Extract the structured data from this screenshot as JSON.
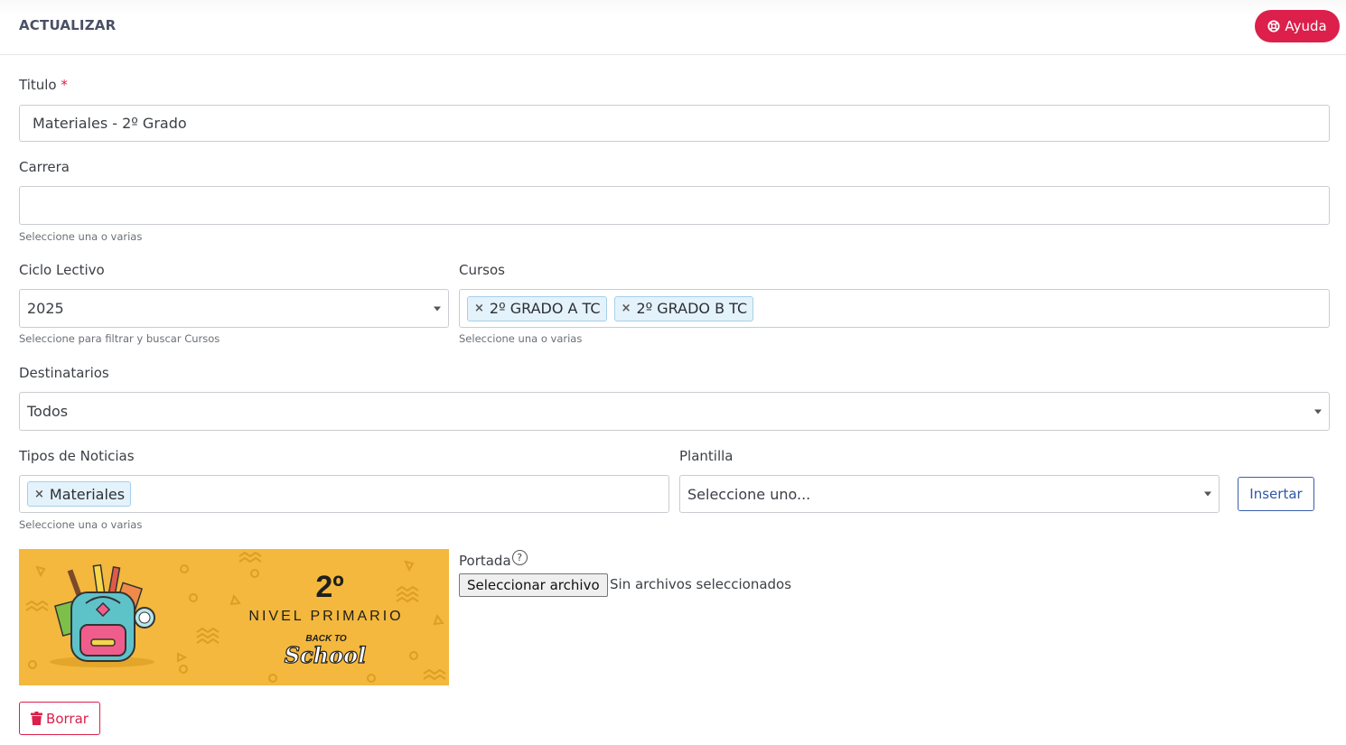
{
  "header": {
    "title": "ACTUALIZAR",
    "help_label": "Ayuda"
  },
  "titulo": {
    "label": "Titulo",
    "required_mark": "*",
    "value": "Materiales - 2º Grado"
  },
  "carrera": {
    "label": "Carrera",
    "value": "",
    "hint": "Seleccione una o varias"
  },
  "ciclo": {
    "label": "Ciclo Lectivo",
    "value": "2025",
    "hint": "Seleccione para filtrar y buscar Cursos"
  },
  "cursos": {
    "label": "Cursos",
    "tags": [
      "2º GRADO A TC",
      "2º GRADO B TC"
    ],
    "hint": "Seleccione una o varias"
  },
  "destinatarios": {
    "label": "Destinatarios",
    "value": "Todos"
  },
  "tipos": {
    "label": "Tipos de Noticias",
    "tags": [
      "Materiales"
    ],
    "hint": "Seleccione una o varias"
  },
  "plantilla": {
    "label": "Plantilla",
    "value": "Seleccione uno...",
    "insert_label": "Insertar"
  },
  "portada": {
    "label": "Portada",
    "help_glyph": "?",
    "button_label": "Seleccionar archivo",
    "status": "Sin archivos seleccionados",
    "image": {
      "grade": "2º",
      "level": "NIVEL PRIMARIO",
      "back_to": "BACK TO",
      "school": "School",
      "bg_color": "#f3b83d"
    }
  },
  "actions": {
    "delete_label": "Borrar"
  },
  "colors": {
    "accent_red": "#dc1f4b",
    "accent_blue": "#2f56a6",
    "tag_bg": "#e4f2fb"
  },
  "icons": {
    "help": "lifebuoy-icon",
    "delete": "trash-icon",
    "remove_tag": "times-icon",
    "dropdown": "caret-down-icon"
  }
}
